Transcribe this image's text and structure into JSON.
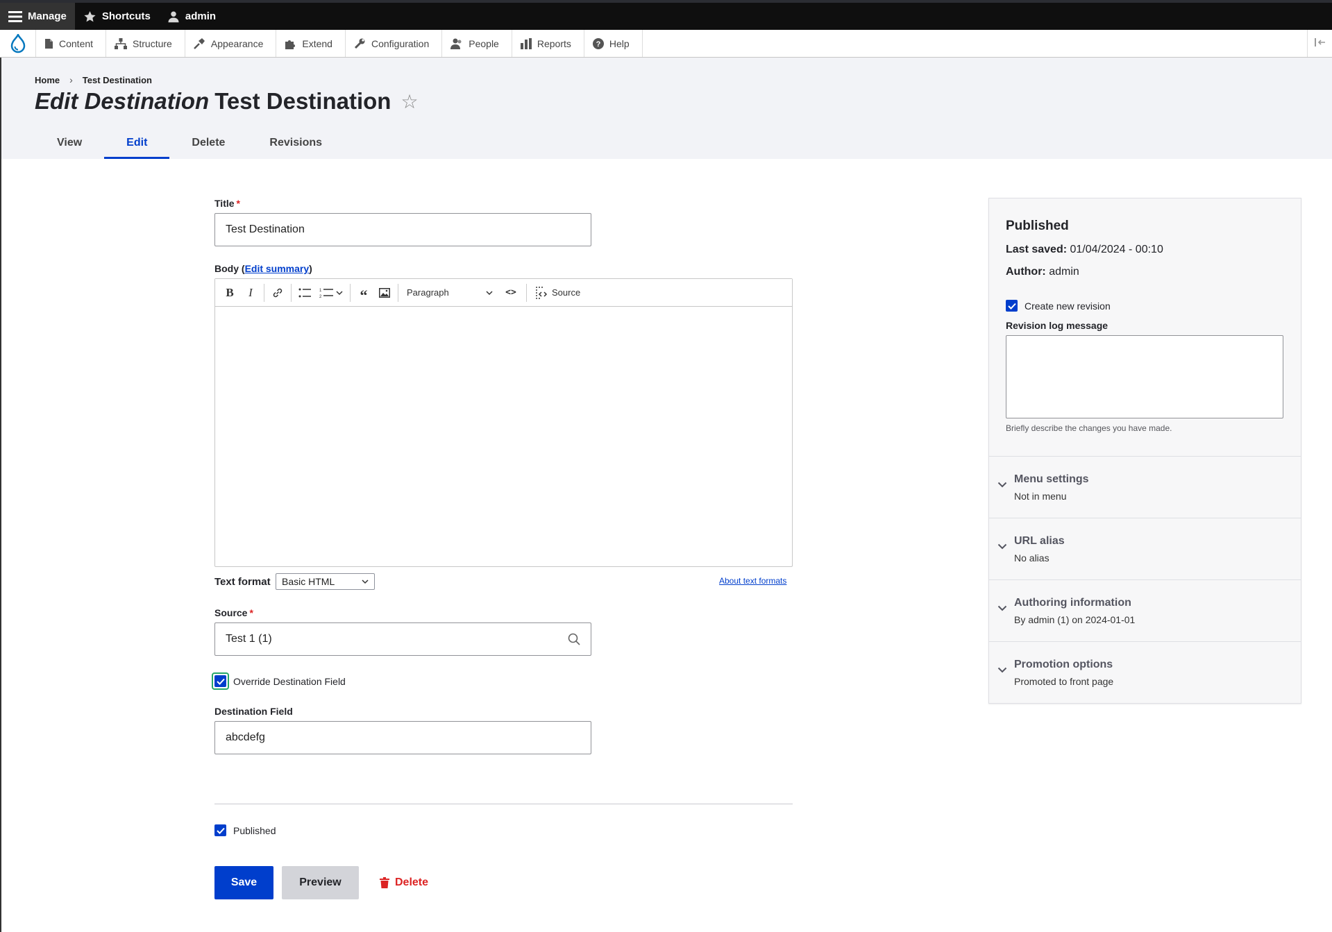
{
  "toolbar": {
    "manage_label": "Manage",
    "shortcuts_label": "Shortcuts",
    "user_label": "admin"
  },
  "tray": {
    "items": [
      {
        "label": "Content",
        "icon": "file-icon"
      },
      {
        "label": "Structure",
        "icon": "sitemap-icon"
      },
      {
        "label": "Appearance",
        "icon": "brush-icon"
      },
      {
        "label": "Extend",
        "icon": "puzzle-icon"
      },
      {
        "label": "Configuration",
        "icon": "wrench-icon"
      },
      {
        "label": "People",
        "icon": "people-icon"
      },
      {
        "label": "Reports",
        "icon": "bar-chart-icon"
      },
      {
        "label": "Help",
        "icon": "help-icon"
      }
    ]
  },
  "breadcrumb": {
    "home": "Home",
    "current": "Test Destination"
  },
  "page": {
    "title_prefix": "Edit Destination",
    "title_entity": "Test Destination",
    "star": "☆"
  },
  "tabs": [
    {
      "label": "View",
      "active": false
    },
    {
      "label": "Edit",
      "active": true
    },
    {
      "label": "Delete",
      "active": false
    },
    {
      "label": "Revisions",
      "active": false
    }
  ],
  "form": {
    "title_label": "Title",
    "title_value": "Test Destination",
    "body_label_prefix": "Body (",
    "body_edit_summary": "Edit summary",
    "body_label_suffix": ")",
    "editor": {
      "paragraph_label": "Paragraph",
      "source_label": "Source"
    },
    "text_format_label": "Text format",
    "text_format_value": "Basic HTML",
    "about_text_formats": "About text formats",
    "source_label": "Source",
    "source_value": "Test 1 (1)",
    "override_label": "Override Destination Field",
    "override_checked": true,
    "destination_label": "Destination Field",
    "destination_value": "abcdefg",
    "published_label": "Published",
    "published_checked": true,
    "save_label": "Save",
    "preview_label": "Preview",
    "delete_label": "Delete"
  },
  "sidebar": {
    "status": "Published",
    "last_saved_label": "Last saved:",
    "last_saved_value": "01/04/2024 - 00:10",
    "author_label": "Author:",
    "author_value": "admin",
    "new_revision_label": "Create new revision",
    "new_revision_checked": true,
    "revision_log_label": "Revision log message",
    "revision_log_value": "",
    "revision_log_help": "Briefly describe the changes you have made.",
    "details": [
      {
        "title": "Menu settings",
        "summary": "Not in menu"
      },
      {
        "title": "URL alias",
        "summary": "No alias"
      },
      {
        "title": "Authoring information",
        "summary": "By admin (1) on 2024-01-01"
      },
      {
        "title": "Promotion options",
        "summary": "Promoted to front page"
      }
    ]
  },
  "colors": {
    "primary": "#003ecc",
    "danger": "#dc2323",
    "focus": "#26a769",
    "toolbar_bg": "#0f0f0f",
    "header_bg": "#f2f3f7"
  }
}
